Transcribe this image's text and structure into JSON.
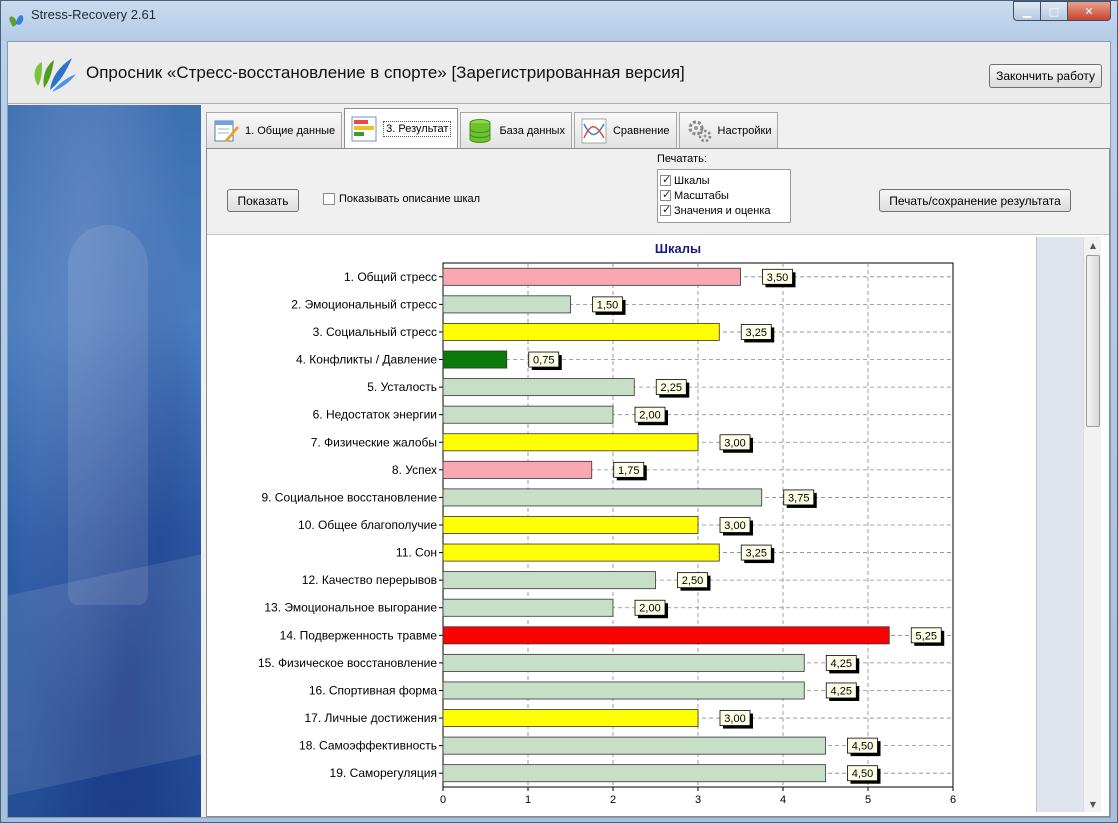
{
  "window": {
    "title": "Stress-Recovery 2.61"
  },
  "header": {
    "title": "Опросник «Стресс-восстановление в спорте» [Зарегистрированная версия]",
    "finish_label": "Закончить работу"
  },
  "tabs": [
    {
      "label": "1. Общие данные",
      "icon": "edit-form-icon"
    },
    {
      "label": "3. Результат",
      "icon": "bar-chart-icon"
    },
    {
      "label": "База данных",
      "icon": "database-icon"
    },
    {
      "label": "Сравнение",
      "icon": "compare-lines-icon"
    },
    {
      "label": "Настройки",
      "icon": "gears-icon"
    }
  ],
  "active_tab": "3. Результат",
  "toolbar": {
    "show_label": "Показать",
    "show_desc_label": "Показывать описание шкал",
    "print_title": "Печатать:",
    "print_options": [
      "Шкалы",
      "Масштабы",
      "Значения и оценка"
    ],
    "print_save_label": "Печать/сохранение результата"
  },
  "colors": {
    "pink": "#f7a8b0",
    "lightgreen": "#c6dfc6",
    "yellow": "#ffff00",
    "darkgreen": "#0a7a0a",
    "red": "#ff0000"
  },
  "chart_data": {
    "type": "bar",
    "orientation": "horizontal",
    "title": "Шкалы",
    "xlim": [
      0,
      6
    ],
    "xticks": [
      "0",
      "1",
      "2",
      "3",
      "4",
      "5",
      "6"
    ],
    "grid": true,
    "categories": [
      "1. Общий стресс",
      "2. Эмоциональный стресс",
      "3. Социальный стресс",
      "4. Конфликты / Давление",
      "5. Усталость",
      "6. Недостаток энергии",
      "7. Физические жалобы",
      "8. Успех",
      "9. Социальное восстановление",
      "10. Общее благополучие",
      "11. Сон",
      "12. Качество перерывов",
      "13. Эмоциональное выгорание",
      "14. Подверженность травме",
      "15. Физическое восстановление",
      "16. Спортивная форма",
      "17. Личные достижения",
      "18. Самоэффективность",
      "19. Саморегуляция"
    ],
    "values": [
      3.5,
      1.5,
      3.25,
      0.75,
      2.25,
      2.0,
      3.0,
      1.75,
      3.75,
      3.0,
      3.25,
      2.5,
      2.0,
      5.25,
      4.25,
      4.25,
      3.0,
      4.5,
      4.5
    ],
    "value_labels": [
      "3,50",
      "1,50",
      "3,25",
      "0,75",
      "2,25",
      "2,00",
      "3,00",
      "1,75",
      "3,75",
      "3,00",
      "3,25",
      "2,50",
      "2,00",
      "5,25",
      "4,25",
      "4,25",
      "3,00",
      "4,50",
      "4,50"
    ],
    "bar_colors": [
      "pink",
      "lightgreen",
      "yellow",
      "darkgreen",
      "lightgreen",
      "lightgreen",
      "yellow",
      "pink",
      "lightgreen",
      "yellow",
      "yellow",
      "lightgreen",
      "lightgreen",
      "red",
      "lightgreen",
      "lightgreen",
      "yellow",
      "lightgreen",
      "lightgreen"
    ]
  }
}
